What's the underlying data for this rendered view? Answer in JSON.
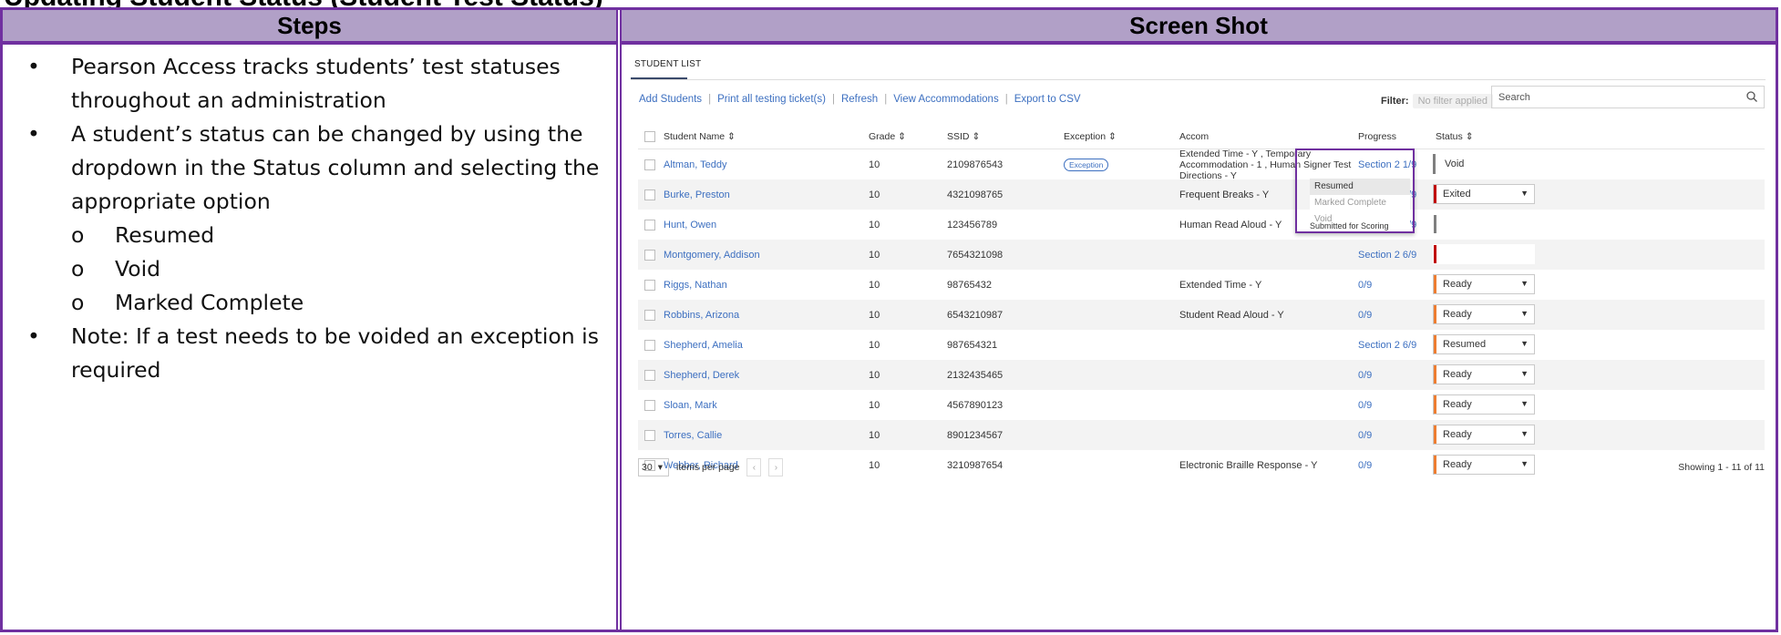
{
  "doc": {
    "page_heading_cut": "Updating Student Status (Student Test Status)",
    "col_steps": "Steps",
    "col_screenshot": "Screen Shot",
    "steps": [
      "Pearson Access tracks students’ test statuses throughout an administration",
      "A student’s status can be changed by using the dropdown in the Status column and selecting the appropriate option"
    ],
    "sub_options": [
      "Resumed",
      "Void",
      "Marked Complete"
    ],
    "note": "Note: If a test needs to be voided an exception is required",
    "bullet": "•",
    "sub_bullet": "o"
  },
  "app": {
    "tab": "STUDENT LIST",
    "actions": [
      "Add Students",
      "Print all testing ticket(s)",
      "Refresh",
      "View Accommodations",
      "Export to CSV"
    ],
    "filter_label": "Filter:",
    "filter_value": "No filter applied",
    "search_placeholder": "Search",
    "columns": [
      "Student Name",
      "Grade",
      "SSID",
      "Exception",
      "Accom",
      "Progress",
      "Status"
    ],
    "sort_glyph": "⇕",
    "rows": [
      {
        "name": "Altman, Teddy",
        "grade": "10",
        "ssid": "2109876543",
        "exception": "Exception",
        "accom": "Extended Time - Y , Temporary Accommodation - 1 , Human Signer Test Directions - Y",
        "progress": "Section 2 1/9",
        "status": "Void",
        "status_color": "#7f7f7f"
      },
      {
        "name": "Burke, Preston",
        "grade": "10",
        "ssid": "4321098765",
        "exception": "",
        "accom": "Frequent Breaks - Y",
        "progress": "Section 2 0/9",
        "status": "Exited",
        "status_color": "#c00000"
      },
      {
        "name": "Hunt, Owen",
        "grade": "10",
        "ssid": "123456789",
        "exception": "",
        "accom": "Human Read Aloud - Y",
        "progress": "Section 1 5/9",
        "status": "",
        "status_color": "#7f7f7f"
      },
      {
        "name": "Montgomery, Addison",
        "grade": "10",
        "ssid": "7654321098",
        "exception": "",
        "accom": "",
        "progress": "Section 2 6/9",
        "status": "",
        "status_color": "#c00000"
      },
      {
        "name": "Riggs, Nathan",
        "grade": "10",
        "ssid": "98765432",
        "exception": "",
        "accom": "Extended Time - Y",
        "progress": "0/9",
        "status": "Ready",
        "status_color": "#ed7d31"
      },
      {
        "name": "Robbins, Arizona",
        "grade": "10",
        "ssid": "6543210987",
        "exception": "",
        "accom": "Student Read Aloud - Y",
        "progress": "0/9",
        "status": "Ready",
        "status_color": "#ed7d31"
      },
      {
        "name": "Shepherd, Amelia",
        "grade": "10",
        "ssid": "987654321",
        "exception": "",
        "accom": "",
        "progress": "Section 2 6/9",
        "status": "Resumed",
        "status_color": "#ed7d31"
      },
      {
        "name": "Shepherd, Derek",
        "grade": "10",
        "ssid": "2132435465",
        "exception": "",
        "accom": "",
        "progress": "0/9",
        "status": "Ready",
        "status_color": "#ed7d31"
      },
      {
        "name": "Sloan, Mark",
        "grade": "10",
        "ssid": "4567890123",
        "exception": "",
        "accom": "",
        "progress": "0/9",
        "status": "Ready",
        "status_color": "#ed7d31"
      },
      {
        "name": "Torres, Callie",
        "grade": "10",
        "ssid": "8901234567",
        "exception": "",
        "accom": "",
        "progress": "0/9",
        "status": "Ready",
        "status_color": "#ed7d31"
      },
      {
        "name": "Webber, Richard",
        "grade": "10",
        "ssid": "3210987654",
        "exception": "",
        "accom": "Electronic Braille Response - Y",
        "progress": "0/9",
        "status": "Ready",
        "status_color": "#ed7d31"
      }
    ],
    "dropdown_options": [
      "Resumed",
      "Marked Complete",
      "Void"
    ],
    "dropdown_underlying_text": "Submitted for Scoring",
    "per_page": "30",
    "per_page_label": "items per page",
    "showing": "Showing 1 - 11 of 11",
    "colors": {
      "link": "#3c6fc0",
      "accent": "#7030a0",
      "header_fill": "#b1a0c7"
    }
  }
}
